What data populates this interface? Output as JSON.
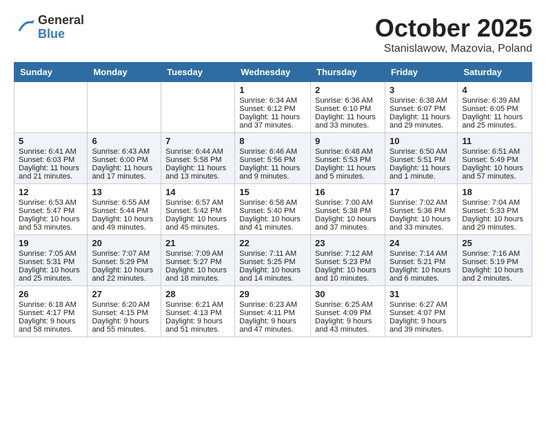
{
  "logo": {
    "line1": "General",
    "line2": "Blue"
  },
  "title": "October 2025",
  "subtitle": "Stanislawow, Mazovia, Poland",
  "days_of_week": [
    "Sunday",
    "Monday",
    "Tuesday",
    "Wednesday",
    "Thursday",
    "Friday",
    "Saturday"
  ],
  "weeks": [
    {
      "days": [
        {
          "num": "",
          "content": ""
        },
        {
          "num": "",
          "content": ""
        },
        {
          "num": "",
          "content": ""
        },
        {
          "num": "1",
          "content": "Sunrise: 6:34 AM\nSunset: 6:12 PM\nDaylight: 11 hours and 37 minutes."
        },
        {
          "num": "2",
          "content": "Sunrise: 6:36 AM\nSunset: 6:10 PM\nDaylight: 11 hours and 33 minutes."
        },
        {
          "num": "3",
          "content": "Sunrise: 6:38 AM\nSunset: 6:07 PM\nDaylight: 11 hours and 29 minutes."
        },
        {
          "num": "4",
          "content": "Sunrise: 6:39 AM\nSunset: 6:05 PM\nDaylight: 11 hours and 25 minutes."
        }
      ]
    },
    {
      "days": [
        {
          "num": "5",
          "content": "Sunrise: 6:41 AM\nSunset: 6:03 PM\nDaylight: 11 hours and 21 minutes."
        },
        {
          "num": "6",
          "content": "Sunrise: 6:43 AM\nSunset: 6:00 PM\nDaylight: 11 hours and 17 minutes."
        },
        {
          "num": "7",
          "content": "Sunrise: 6:44 AM\nSunset: 5:58 PM\nDaylight: 11 hours and 13 minutes."
        },
        {
          "num": "8",
          "content": "Sunrise: 6:46 AM\nSunset: 5:56 PM\nDaylight: 11 hours and 9 minutes."
        },
        {
          "num": "9",
          "content": "Sunrise: 6:48 AM\nSunset: 5:53 PM\nDaylight: 11 hours and 5 minutes."
        },
        {
          "num": "10",
          "content": "Sunrise: 6:50 AM\nSunset: 5:51 PM\nDaylight: 11 hours and 1 minute."
        },
        {
          "num": "11",
          "content": "Sunrise: 6:51 AM\nSunset: 5:49 PM\nDaylight: 10 hours and 57 minutes."
        }
      ]
    },
    {
      "days": [
        {
          "num": "12",
          "content": "Sunrise: 6:53 AM\nSunset: 5:47 PM\nDaylight: 10 hours and 53 minutes."
        },
        {
          "num": "13",
          "content": "Sunrise: 6:55 AM\nSunset: 5:44 PM\nDaylight: 10 hours and 49 minutes."
        },
        {
          "num": "14",
          "content": "Sunrise: 6:57 AM\nSunset: 5:42 PM\nDaylight: 10 hours and 45 minutes."
        },
        {
          "num": "15",
          "content": "Sunrise: 6:58 AM\nSunset: 5:40 PM\nDaylight: 10 hours and 41 minutes."
        },
        {
          "num": "16",
          "content": "Sunrise: 7:00 AM\nSunset: 5:38 PM\nDaylight: 10 hours and 37 minutes."
        },
        {
          "num": "17",
          "content": "Sunrise: 7:02 AM\nSunset: 5:36 PM\nDaylight: 10 hours and 33 minutes."
        },
        {
          "num": "18",
          "content": "Sunrise: 7:04 AM\nSunset: 5:33 PM\nDaylight: 10 hours and 29 minutes."
        }
      ]
    },
    {
      "days": [
        {
          "num": "19",
          "content": "Sunrise: 7:05 AM\nSunset: 5:31 PM\nDaylight: 10 hours and 25 minutes."
        },
        {
          "num": "20",
          "content": "Sunrise: 7:07 AM\nSunset: 5:29 PM\nDaylight: 10 hours and 22 minutes."
        },
        {
          "num": "21",
          "content": "Sunrise: 7:09 AM\nSunset: 5:27 PM\nDaylight: 10 hours and 18 minutes."
        },
        {
          "num": "22",
          "content": "Sunrise: 7:11 AM\nSunset: 5:25 PM\nDaylight: 10 hours and 14 minutes."
        },
        {
          "num": "23",
          "content": "Sunrise: 7:12 AM\nSunset: 5:23 PM\nDaylight: 10 hours and 10 minutes."
        },
        {
          "num": "24",
          "content": "Sunrise: 7:14 AM\nSunset: 5:21 PM\nDaylight: 10 hours and 6 minutes."
        },
        {
          "num": "25",
          "content": "Sunrise: 7:16 AM\nSunset: 5:19 PM\nDaylight: 10 hours and 2 minutes."
        }
      ]
    },
    {
      "days": [
        {
          "num": "26",
          "content": "Sunrise: 6:18 AM\nSunset: 4:17 PM\nDaylight: 9 hours and 58 minutes."
        },
        {
          "num": "27",
          "content": "Sunrise: 6:20 AM\nSunset: 4:15 PM\nDaylight: 9 hours and 55 minutes."
        },
        {
          "num": "28",
          "content": "Sunrise: 6:21 AM\nSunset: 4:13 PM\nDaylight: 9 hours and 51 minutes."
        },
        {
          "num": "29",
          "content": "Sunrise: 6:23 AM\nSunset: 4:11 PM\nDaylight: 9 hours and 47 minutes."
        },
        {
          "num": "30",
          "content": "Sunrise: 6:25 AM\nSunset: 4:09 PM\nDaylight: 9 hours and 43 minutes."
        },
        {
          "num": "31",
          "content": "Sunrise: 6:27 AM\nSunset: 4:07 PM\nDaylight: 9 hours and 39 minutes."
        },
        {
          "num": "",
          "content": ""
        }
      ]
    }
  ]
}
